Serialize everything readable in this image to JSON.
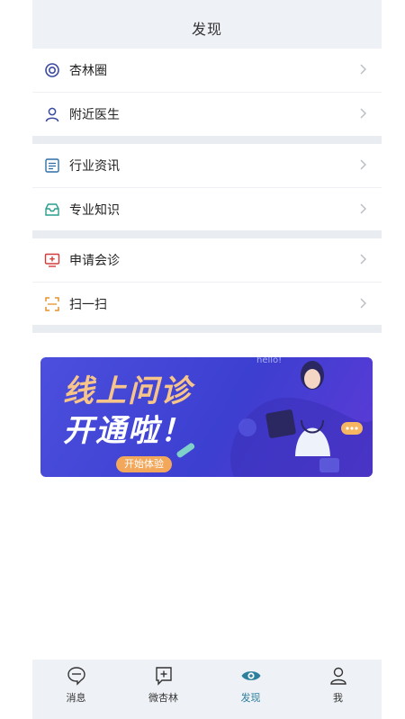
{
  "header": {
    "title": "发现"
  },
  "groups": [
    {
      "items": [
        {
          "label": "杏林圈",
          "icon": "circle-target-icon"
        },
        {
          "label": "附近医生",
          "icon": "person-icon"
        }
      ]
    },
    {
      "items": [
        {
          "label": "行业资讯",
          "icon": "news-list-icon"
        },
        {
          "label": "专业知识",
          "icon": "inbox-tray-icon"
        }
      ]
    },
    {
      "items": [
        {
          "label": "申请会诊",
          "icon": "monitor-plus-icon"
        },
        {
          "label": "扫一扫",
          "icon": "scan-frame-icon"
        }
      ]
    }
  ],
  "banner": {
    "line1": "线上问诊",
    "line2": "开通啦！",
    "button": "开始体验",
    "bubble": "hello!",
    "colors": {
      "bg": "#4347d6",
      "title": "#ffffff",
      "accent": "#f6b560"
    }
  },
  "tabbar": {
    "items": [
      {
        "label": "消息",
        "icon": "chat-bubble-icon",
        "active": false
      },
      {
        "label": "微杏林",
        "icon": "plus-bubble-icon",
        "active": false
      },
      {
        "label": "发现",
        "icon": "eye-icon",
        "active": true
      },
      {
        "label": "我",
        "icon": "user-icon",
        "active": false
      }
    ],
    "active_color": "#2d7f9e"
  }
}
